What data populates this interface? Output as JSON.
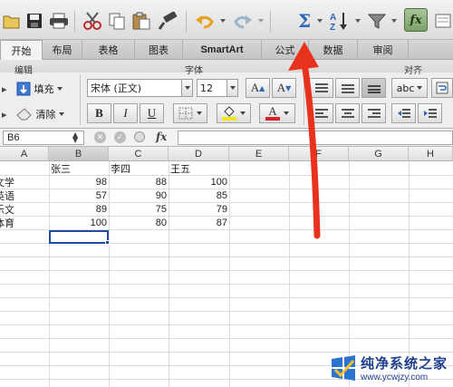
{
  "toolbar": {
    "buttons": [
      "folder-icon",
      "save-icon",
      "print-icon",
      "cut-icon",
      "copy-icon",
      "paste-icon",
      "format-painter-icon",
      "undo-icon",
      "redo-icon",
      "autosum-icon",
      "sort-icon",
      "filter-icon",
      "formula-builder-icon"
    ],
    "formula_builder_label": "fx"
  },
  "tabs": [
    {
      "label": "开始",
      "active": true
    },
    {
      "label": "布局"
    },
    {
      "label": "表格"
    },
    {
      "label": "图表"
    },
    {
      "label": "SmartArt"
    },
    {
      "label": "公式"
    },
    {
      "label": "数据"
    },
    {
      "label": "审阅"
    }
  ],
  "ribbon": {
    "groups": {
      "edit": "编辑",
      "font": "字体",
      "align": "对齐"
    },
    "fill_label": "填充",
    "clear_label": "清除",
    "font_name": "宋体 (正文)",
    "font_size": "12",
    "bold": "B",
    "italic": "I",
    "underline": "U",
    "wrap_label": "abc",
    "grow_font": "A",
    "shrink_font": "A",
    "font_color_label": "A",
    "highlight_color": "#f5e61a",
    "font_color": "#d8232a"
  },
  "formula_bar": {
    "name_box": "B6",
    "fx_label": "fx",
    "value": ""
  },
  "sheet": {
    "columns": [
      "A",
      "B",
      "C",
      "D",
      "E",
      "F",
      "G",
      "H"
    ],
    "selected_column": "B",
    "selected_cell": "B6",
    "header_row": [
      "张三",
      "李四",
      "王五"
    ],
    "rows": [
      {
        "label": "文学",
        "values": [
          98,
          88,
          100
        ]
      },
      {
        "label": "英语",
        "values": [
          57,
          90,
          85
        ]
      },
      {
        "label": "乐文",
        "values": [
          89,
          75,
          79
        ]
      },
      {
        "label": "体育",
        "values": [
          100,
          80,
          87
        ]
      }
    ]
  },
  "annotation": {
    "arrow_color": "#e8321e"
  },
  "watermark": {
    "title": "纯净系统之家",
    "url": "www.ycwjzy.com"
  }
}
